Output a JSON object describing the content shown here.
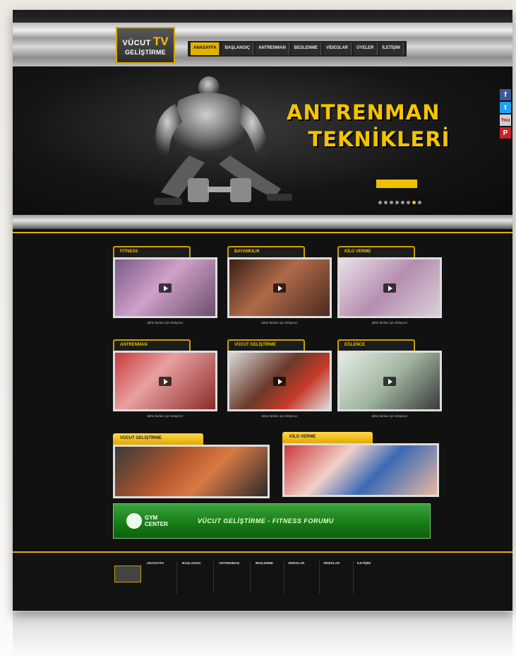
{
  "logo": {
    "line1": "VÜCUT",
    "tv": "TV",
    "line2": "GELİŞTİRME"
  },
  "nav": [
    "ANASAYFA",
    "BAŞLANGIÇ",
    "ANTRENMAN",
    "BESLENME",
    "VİDEOLAR",
    "ÜYELER",
    "İLETİŞİM"
  ],
  "hero": {
    "line1": "ANTRENMAN",
    "line2": "TEKNİKLERİ",
    "slide_count": 8,
    "active_slide": 7
  },
  "social": [
    "f",
    "t",
    "You",
    "P"
  ],
  "videos": [
    {
      "title": "FITNESS",
      "caption": "daha fazlası için tıklayınız"
    },
    {
      "title": "BAYANKILIK",
      "caption": "daha fazlası için tıklayınız"
    },
    {
      "title": "KİLO VERME",
      "caption": "daha fazlası için tıklayınız"
    },
    {
      "title": "ANTRENMAN",
      "caption": "daha fazlası için tıklayınız"
    },
    {
      "title": "VÜCUT GELİŞTİRME",
      "caption": "daha fazlası için tıklayınız"
    },
    {
      "title": "EĞLENCE",
      "caption": "daha fazlası için tıklayınız"
    }
  ],
  "wide_cards": [
    {
      "title": "VÜCUT GELİŞTİRME"
    },
    {
      "title": "KİLO VERME"
    }
  ],
  "gym_banner": {
    "logo_line1": "GYM",
    "logo_line2": "CENTER",
    "title": "VÜCUT GELİŞTİRME - FITNESS FORUMU"
  },
  "footer": {
    "columns": [
      {
        "title": "ANASAYFA",
        "items": []
      },
      {
        "title": "BAŞLANGIÇ",
        "items": []
      },
      {
        "title": "ANTRENMAN",
        "items": []
      },
      {
        "title": "BESLENME",
        "items": []
      },
      {
        "title": "VİDEOLAR",
        "items": []
      },
      {
        "title": "VİDEOLAR",
        "items": []
      },
      {
        "title": "İLETİŞİM",
        "items": []
      }
    ]
  },
  "colors": {
    "accent": "#f0c000",
    "banner": "#167a16",
    "background": "#111111"
  }
}
